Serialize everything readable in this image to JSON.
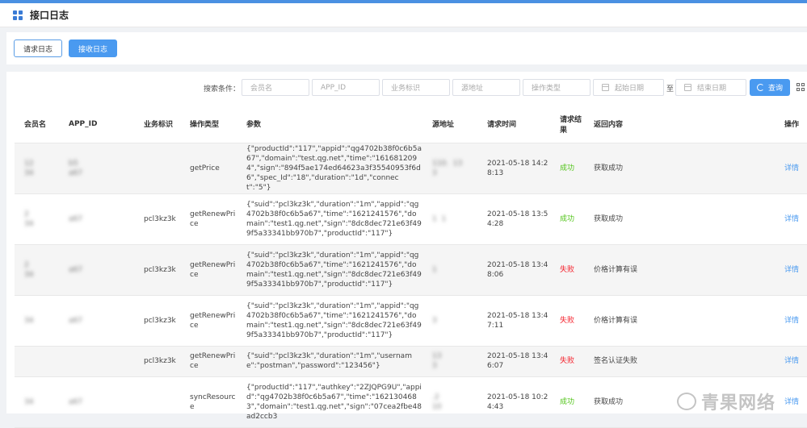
{
  "header": {
    "title": "接口日志"
  },
  "tabs": [
    {
      "label": "请求日志",
      "active": false
    },
    {
      "label": "接收日志",
      "active": true
    }
  ],
  "filters": {
    "label": "搜索条件：",
    "member_placeholder": "会员名",
    "appid_placeholder": "APP_ID",
    "biz_placeholder": "业务标识",
    "source_placeholder": "源地址",
    "optype_placeholder": "操作类型",
    "start_date_placeholder": "起始日期",
    "range_sep": "至",
    "end_date_placeholder": "结束日期",
    "query_label": "查询"
  },
  "table": {
    "headers": [
      "会员名",
      "APP_ID",
      "业务标识",
      "操作类型",
      "参数",
      "源地址",
      "请求时间",
      "请求结果",
      "返回内容",
      "操作"
    ],
    "rows": [
      {
        "member": "12\n34",
        "appid": "b5\na67",
        "biz": "",
        "op": "getPrice",
        "params": "{\"productId\":\"117\",\"appid\":\"qg4702b38f0c6b5a67\",\"domain\":\"test.qg.net\",\"time\":\"1616812094\",\"sign\":\"894f5ae174ed64623a3f35540953f6d6\",\"spec_Id\":\"18\",\"duration\":\"1d\",\"connect\":\"5\"}",
        "source": "110.  13\n3",
        "time": "2021-05-18 14:28:13",
        "result": "成功",
        "result_status": "success",
        "response": "获取成功",
        "action": "详情"
      },
      {
        "member": "2\n34",
        "appid": "a67",
        "biz": "pcl3kz3k",
        "op": "getRenewPrice",
        "params": "{\"suid\":\"pcl3kz3k\",\"duration\":\"1m\",\"appid\":\"qg4702b38f0c6b5a67\",\"time\":\"1621241576\",\"domain\":\"test1.qg.net\",\"sign\":\"8dc8dec721e63f499f5a33341bb970b7\",\"productId\":\"117\"}",
        "source": "1  1",
        "time": "2021-05-18 13:54:28",
        "result": "成功",
        "result_status": "success",
        "response": "获取成功",
        "action": "详情"
      },
      {
        "member": "2\n34",
        "appid": "a67",
        "biz": "pcl3kz3k",
        "op": "getRenewPrice",
        "params": "{\"suid\":\"pcl3kz3k\",\"duration\":\"1m\",\"appid\":\"qg4702b38f0c6b5a67\",\"time\":\"1621241576\",\"domain\":\"test1.qg.net\",\"sign\":\"8dc8dec721e63f499f5a33341bb970b7\",\"productId\":\"117\"}",
        "source": "1",
        "time": "2021-05-18 13:48:06",
        "result": "失败",
        "result_status": "fail",
        "response": "价格计算有误",
        "action": "详情"
      },
      {
        "member": "34",
        "appid": "a67",
        "biz": "pcl3kz3k",
        "op": "getRenewPrice",
        "params": "{\"suid\":\"pcl3kz3k\",\"duration\":\"1m\",\"appid\":\"qg4702b38f0c6b5a67\",\"time\":\"1621241576\",\"domain\":\"test1.qg.net\",\"sign\":\"8dc8dec721e63f499f5a33341bb970b7\",\"productId\":\"117\"}",
        "source": "3",
        "time": "2021-05-18 13:47:11",
        "result": "失败",
        "result_status": "fail",
        "response": "价格计算有误",
        "action": "详情"
      },
      {
        "member": "",
        "appid": "",
        "biz": "pcl3kz3k",
        "op": "getRenewPrice",
        "params": "{\"suid\":\"pcl3kz3k\",\"duration\":\"1m\",\"username\":\"postman\",\"password\":\"123456\"}",
        "source": "13\n3",
        "time": "2021-05-18 13:46:07",
        "result": "失败",
        "result_status": "fail",
        "response": "签名认证失败",
        "action": "详情"
      },
      {
        "member": "34",
        "appid": "a67",
        "biz": "",
        "op": "syncResource",
        "params": "{\"productId\":\"117\",\"authkey\":\"2ZJQPG9U\",\"appid\":\"qg4702b38f0c6b5a67\",\"time\":\"1621304683\",\"domain\":\"test1.qg.net\",\"sign\":\"07cea2fbe48ad2ccb3",
        "source": ".2\n10",
        "time": "2021-05-18 10:24:43",
        "result": "成功",
        "result_status": "success",
        "response": "获取成功",
        "action": "详情"
      }
    ]
  },
  "watermark": "青果网络",
  "colors": {
    "accent": "#4a9af0",
    "success": "#52c41a",
    "fail": "#f5222d"
  }
}
